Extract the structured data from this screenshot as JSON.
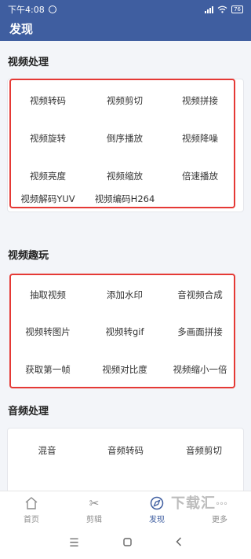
{
  "status_bar": {
    "time": "下午4:08",
    "battery": "76"
  },
  "app_bar": {
    "title": "发现"
  },
  "sections": [
    {
      "title": "视频处理",
      "items": [
        "视频转码",
        "视频剪切",
        "视频拼接",
        "视频旋转",
        "倒序播放",
        "视频降噪",
        "视频亮度",
        "视频缩放",
        "倍速播放",
        "视频解码YUV",
        "视频编码H264"
      ]
    },
    {
      "title": "视频趣玩",
      "items": [
        "抽取视频",
        "添加水印",
        "音视频合成",
        "视频转图片",
        "视频转gif",
        "多画面拼接",
        "获取第一帧",
        "视频对比度",
        "视频缩小一倍"
      ]
    },
    {
      "title": "音频处理",
      "items": [
        "混音",
        "音频转码",
        "音频剪切"
      ]
    }
  ],
  "bottom_nav": [
    {
      "label": "首页",
      "icon": "home-icon"
    },
    {
      "label": "剪辑",
      "icon": "scissors-icon"
    },
    {
      "label": "发现",
      "icon": "discover-icon",
      "active": true
    },
    {
      "label": "更多",
      "icon": "more-icon"
    }
  ],
  "watermark": {
    "text": "下载汇",
    "dots": "°°°"
  },
  "highlight_color": "#e53935",
  "brand_color": "#3f5ea0"
}
